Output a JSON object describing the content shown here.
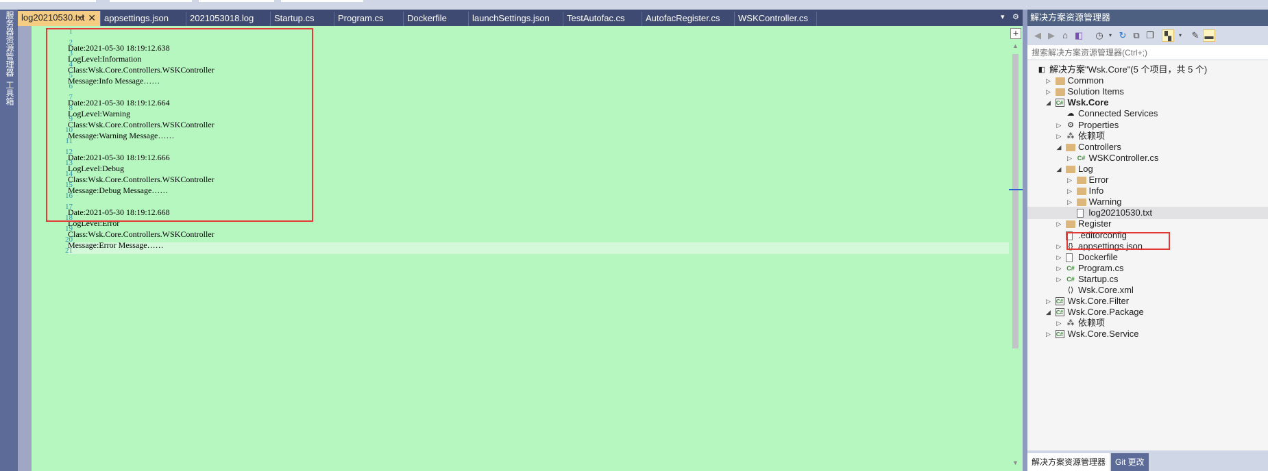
{
  "left_rail": {
    "tab1": "服务器资源管理器",
    "tab2": "工具箱"
  },
  "tabs": [
    {
      "label": "log20210530.txt",
      "pin": "⊣",
      "close": "✕"
    },
    {
      "label": "appsettings.json"
    },
    {
      "label": "2021053018.log"
    },
    {
      "label": "Startup.cs"
    },
    {
      "label": "Program.cs"
    },
    {
      "label": "Dockerfile"
    },
    {
      "label": "launchSettings.json"
    },
    {
      "label": "TestAutofac.cs"
    },
    {
      "label": "AutofacRegister.cs"
    },
    {
      "label": "WSKController.cs"
    }
  ],
  "tab_overflow_icon": "▾",
  "settings_icon": "⚙",
  "editor": {
    "line_numbers": [
      "1",
      "2",
      "3",
      "4",
      "5",
      "6",
      "7",
      "8",
      "9",
      "10",
      "11",
      "12",
      "13",
      "14",
      "15",
      "16",
      "17",
      "18",
      "19",
      "20",
      "21"
    ],
    "lines": [
      "",
      "Date:2021-05-30 18:19:12.638",
      "LogLevel:Information",
      "Class:Wsk.Core.Controllers.WSKController",
      "Message:Info Message……",
      "",
      "Date:2021-05-30 18:19:12.664",
      "LogLevel:Warning",
      "Class:Wsk.Core.Controllers.WSKController",
      "Message:Warning Message……",
      "",
      "Date:2021-05-30 18:19:12.666",
      "LogLevel:Debug",
      "Class:Wsk.Core.Controllers.WSKController",
      "Message:Debug Message……",
      "",
      "Date:2021-05-30 18:19:12.668",
      "LogLevel:Error",
      "Class:Wsk.Core.Controllers.WSKController",
      "Message:Error Message……",
      ""
    ],
    "split_button": "+"
  },
  "solution_explorer": {
    "title": "解决方案资源管理器",
    "search_placeholder": "搜索解决方案资源管理器(Ctrl+;)",
    "toolbar_icons": [
      "back-icon",
      "forward-icon",
      "home-icon",
      "vs-icon",
      "history-icon",
      "refresh-icon",
      "collapse-all-icon",
      "copy-icon",
      "show-all-files-icon",
      "properties-icon",
      "preview-icon"
    ],
    "tree": [
      {
        "label": "解决方案\"Wsk.Core\"(5 个项目，共 5 个)",
        "icon": "solution"
      },
      {
        "label": "Common",
        "icon": "folder",
        "exp": "▷"
      },
      {
        "label": "Solution Items",
        "icon": "folder",
        "exp": "▷"
      },
      {
        "label": "Wsk.Core",
        "icon": "project",
        "exp": "◢"
      },
      {
        "label": "Connected Services",
        "icon": "cloud"
      },
      {
        "label": "Properties",
        "icon": "wrench",
        "exp": "▷"
      },
      {
        "label": "依赖项",
        "icon": "deps",
        "exp": "▷"
      },
      {
        "label": "Controllers",
        "icon": "folder",
        "exp": "◢"
      },
      {
        "label": "WSKController.cs",
        "icon": "cs",
        "exp": "▷"
      },
      {
        "label": "Log",
        "icon": "folder",
        "exp": "◢"
      },
      {
        "label": "Error",
        "icon": "folder",
        "exp": "▷"
      },
      {
        "label": "Info",
        "icon": "folder",
        "exp": "▷"
      },
      {
        "label": "Warning",
        "icon": "folder",
        "exp": "▷"
      },
      {
        "label": "log20210530.txt",
        "icon": "file"
      },
      {
        "label": "Register",
        "icon": "folder",
        "exp": "▷"
      },
      {
        "label": ".editorconfig",
        "icon": "file"
      },
      {
        "label": "appsettings.json",
        "icon": "json",
        "exp": "▷"
      },
      {
        "label": "Dockerfile",
        "icon": "file",
        "exp": "▷"
      },
      {
        "label": "Program.cs",
        "icon": "cs",
        "exp": "▷"
      },
      {
        "label": "Startup.cs",
        "icon": "cs",
        "exp": "▷"
      },
      {
        "label": "Wsk.Core.xml",
        "icon": "xml"
      },
      {
        "label": "Wsk.Core.Filter",
        "icon": "project",
        "exp": "▷"
      },
      {
        "label": "Wsk.Core.Package",
        "icon": "project",
        "exp": "◢"
      },
      {
        "label": "依赖项",
        "icon": "deps",
        "exp": "▷"
      },
      {
        "label": "Wsk.Core.Service",
        "icon": "project",
        "exp": "▷"
      }
    ],
    "bottom_tabs": [
      "解决方案资源管理器",
      "Git 更改"
    ]
  }
}
